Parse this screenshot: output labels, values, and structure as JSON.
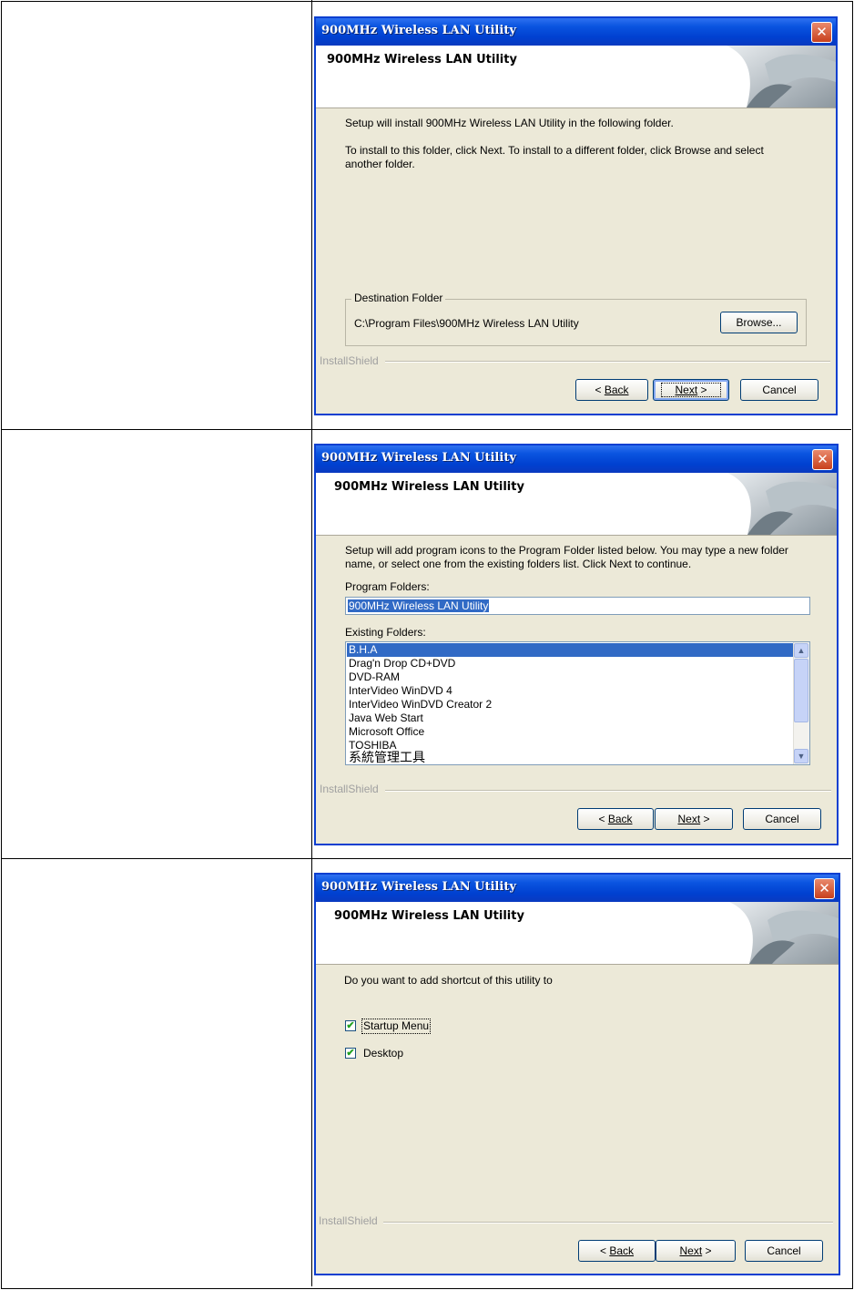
{
  "app_title": "900MHz Wireless LAN Utility",
  "header_title": "900MHz Wireless LAN Utility",
  "installshield": "InstallShield",
  "buttons": {
    "back_prefix": "< ",
    "back": "Back",
    "next": "Next",
    "next_suffix": " >",
    "cancel": "Cancel",
    "browse": "Browse..."
  },
  "step1": {
    "line1": "Setup will install 900MHz Wireless LAN Utility in the following folder.",
    "line2": "To install to this folder, click Next. To install to a different folder, click Browse and select another folder.",
    "dest_label": "Destination Folder",
    "dest_path": "C:\\Program Files\\900MHz Wireless LAN Utility"
  },
  "step2": {
    "intro": "Setup will add program icons to the Program Folder listed below.  You may type a new folder name, or select one from the existing folders list.  Click Next to continue.",
    "program_folders_label": "Program Folders:",
    "program_folder_value": "900MHz Wireless LAN Utility",
    "existing_folders_label": "Existing Folders:",
    "existing_folders": [
      "B.H.A",
      "Drag'n Drop CD+DVD",
      "DVD-RAM",
      "InterVideo WinDVD 4",
      "InterVideo WinDVD Creator 2",
      "Java Web Start",
      "Microsoft Office",
      "TOSHIBA",
      "系統管理工具"
    ],
    "selected_index": 0
  },
  "step3": {
    "question": "Do you want to add shortcut of this utility to",
    "options": [
      {
        "label": "Startup Menu",
        "checked": true
      },
      {
        "label": "Desktop",
        "checked": true
      }
    ]
  }
}
